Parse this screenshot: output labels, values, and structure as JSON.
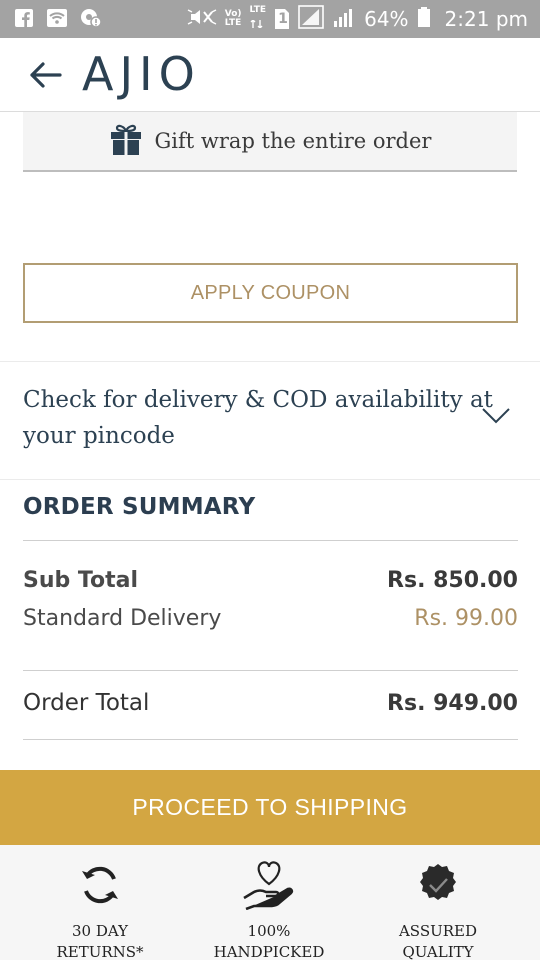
{
  "status_bar": {
    "icons_left": [
      "facebook-icon",
      "wifi-icon",
      "notification-icon"
    ],
    "icons_right": [
      "mute-icon",
      "volte-icon",
      "lte-icon",
      "sim-1-icon",
      "signal-icon",
      "signal-icon",
      "battery-icon"
    ],
    "volte_label": "Vo)\nLTE",
    "lte_label": "LTE",
    "sim_label": "1",
    "battery_percent": "64%",
    "time": "2:21 pm"
  },
  "header": {
    "back_icon": "arrow-left-icon",
    "logo": "AJIO"
  },
  "gift_wrap": {
    "icon": "gift-icon",
    "label": "Gift wrap the entire order"
  },
  "coupon": {
    "label": "APPLY COUPON"
  },
  "pincode": {
    "label": "Check for delivery & COD availability at your pincode",
    "icon": "chevron-down-icon"
  },
  "order_summary": {
    "title": "ORDER SUMMARY",
    "subtotal_label": "Sub Total",
    "subtotal_value": "Rs. 850.00",
    "delivery_label": "Standard Delivery",
    "delivery_value": "Rs. 99.00",
    "total_label": "Order Total",
    "total_value": "Rs. 949.00"
  },
  "proceed": {
    "label": "PROCEED TO SHIPPING"
  },
  "features": [
    {
      "icon": "returns-icon",
      "line1": "30 DAY",
      "line2": "RETURNS*"
    },
    {
      "icon": "handpicked-icon",
      "line1": "100%",
      "line2": "HANDPICKED"
    },
    {
      "icon": "assured-quality-icon",
      "line1": "ASSURED",
      "line2": "QUALITY"
    }
  ],
  "colors": {
    "brand_navy": "#2c4152",
    "gold_accent": "#ad9165",
    "proceed_background": "#d3a642",
    "status_bar": "#a3a3a3"
  }
}
